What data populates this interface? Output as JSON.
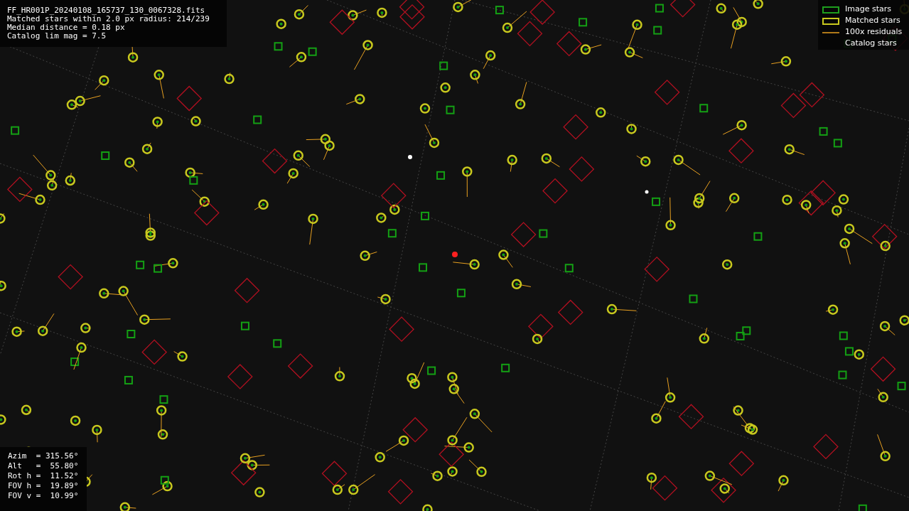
{
  "header": {
    "lines": [
      "FF_HR001P_20240108_165737_130_0067328.fits",
      "Matched stars within 2.0 px radius: 214/239",
      "Median distance = 0.18 px",
      "Catalog lim mag = 7.5"
    ]
  },
  "legend": [
    {
      "kind": "image",
      "label": "Image stars"
    },
    {
      "kind": "matched",
      "label": "Matched stars"
    },
    {
      "kind": "residual",
      "label": "100x residuals"
    },
    {
      "kind": "catalog",
      "label": "Catalog stars"
    }
  ],
  "pointing": {
    "lines": [
      "Azim  = 315.56°",
      "Alt   =  55.80°",
      "Rot h =  11.52°",
      "FOV h =  19.89°",
      "FOV v =  10.99°"
    ]
  }
}
